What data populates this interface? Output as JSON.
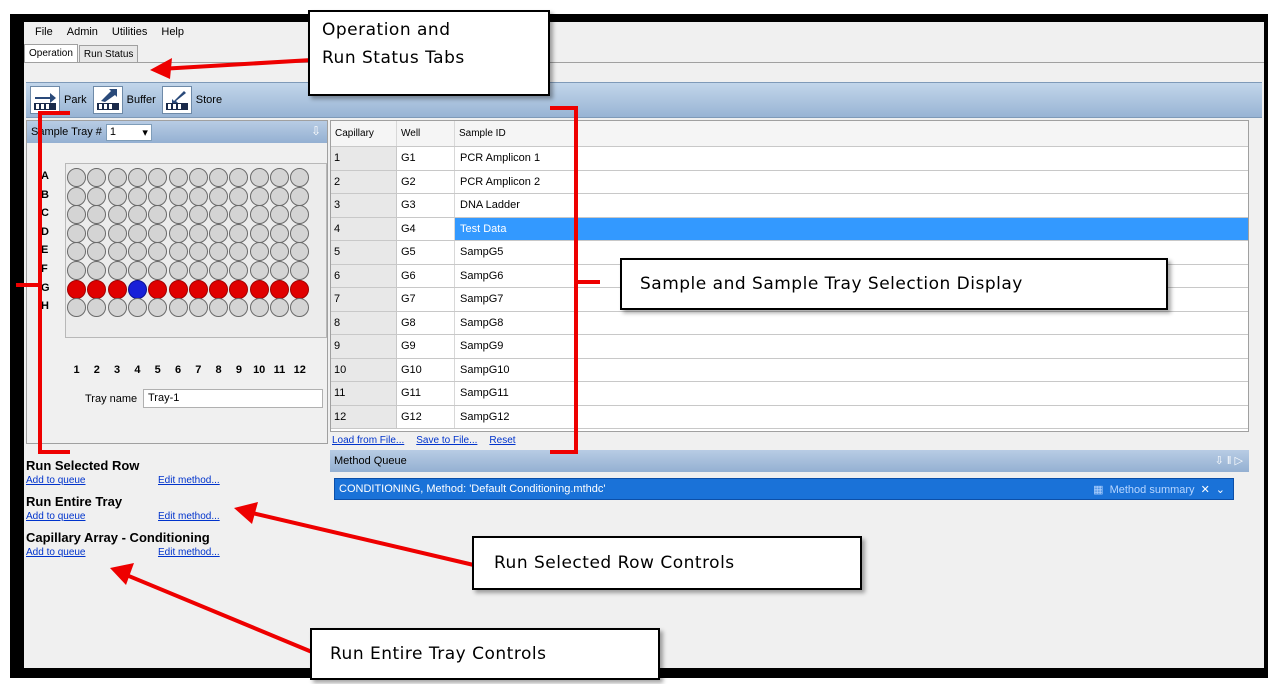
{
  "menu": [
    "File",
    "Admin",
    "Utilities",
    "Help"
  ],
  "tabs": [
    "Operation",
    "Run Status"
  ],
  "toolbar": [
    {
      "label": "Park",
      "icon": "park-icon"
    },
    {
      "label": "Buffer",
      "icon": "buffer-icon"
    },
    {
      "label": "Store",
      "icon": "store-icon"
    }
  ],
  "tray": {
    "label": "Sample Tray #",
    "selected": "1",
    "rows": [
      "A",
      "B",
      "C",
      "D",
      "E",
      "F",
      "G",
      "H"
    ],
    "columns": [
      "1",
      "2",
      "3",
      "4",
      "5",
      "6",
      "7",
      "8",
      "9",
      "10",
      "11",
      "12"
    ],
    "selected_row": "G",
    "highlighted_well": "G4",
    "name_label": "Tray name",
    "name_value": "Tray-1"
  },
  "grid": {
    "headers": [
      "Capillary",
      "Well",
      "Sample ID"
    ],
    "rows": [
      {
        "capillary": "1",
        "well": "G1",
        "sample": "PCR Amplicon 1"
      },
      {
        "capillary": "2",
        "well": "G2",
        "sample": "PCR Amplicon 2"
      },
      {
        "capillary": "3",
        "well": "G3",
        "sample": "DNA Ladder"
      },
      {
        "capillary": "4",
        "well": "G4",
        "sample": "Test Data"
      },
      {
        "capillary": "5",
        "well": "G5",
        "sample": "SampG5"
      },
      {
        "capillary": "6",
        "well": "G6",
        "sample": "SampG6"
      },
      {
        "capillary": "7",
        "well": "G7",
        "sample": "SampG7"
      },
      {
        "capillary": "8",
        "well": "G8",
        "sample": "SampG8"
      },
      {
        "capillary": "9",
        "well": "G9",
        "sample": "SampG9"
      },
      {
        "capillary": "10",
        "well": "G10",
        "sample": "SampG10"
      },
      {
        "capillary": "11",
        "well": "G11",
        "sample": "SampG11"
      },
      {
        "capillary": "12",
        "well": "G12",
        "sample": "SampG12"
      }
    ],
    "selected_index": 3,
    "links": [
      "Load from File...",
      "Save to File...",
      "Reset"
    ]
  },
  "method_queue": {
    "title": "Method Queue",
    "item": "CONDITIONING, Method: 'Default Conditioning.mthdc'",
    "summary": "Method summary"
  },
  "run": [
    {
      "title": "Run Selected Row",
      "add": "Add to queue",
      "edit": "Edit method..."
    },
    {
      "title": "Run Entire Tray",
      "add": "Add to queue",
      "edit": "Edit method..."
    },
    {
      "title": "Capillary Array - Conditioning",
      "add": "Add to queue",
      "edit": "Edit method..."
    }
  ],
  "callouts": {
    "tabs": [
      "Operation and",
      "Run Status Tabs"
    ],
    "sample_display": "Sample and Sample Tray Selection Display",
    "row_controls": "Run Selected Row Controls",
    "tray_controls": "Run Entire Tray Controls"
  },
  "colors": {
    "selected_well": "#e00000",
    "highlighted_well": "#1820d8",
    "selection": "#3399ff",
    "annotation": "#ee0000"
  }
}
